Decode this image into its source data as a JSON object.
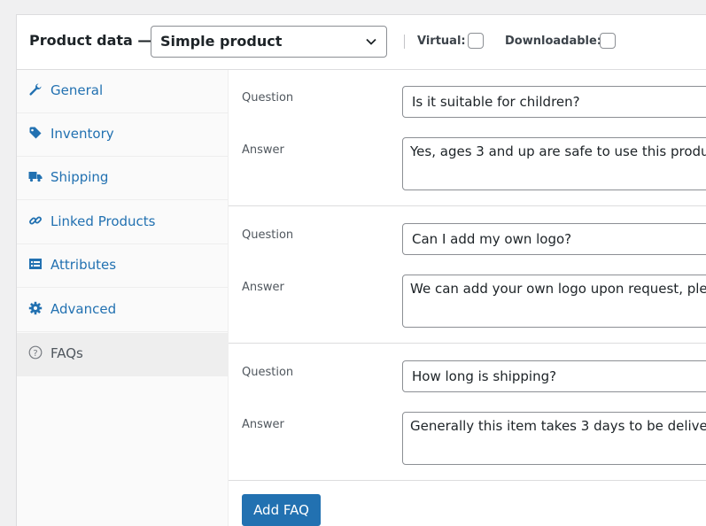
{
  "header": {
    "title": "Product data —",
    "product_type": "Simple product",
    "virtual_label": "Virtual:",
    "downloadable_label": "Downloadable:"
  },
  "sidebar": {
    "items": [
      {
        "label": "General",
        "icon": "wrench-icon"
      },
      {
        "label": "Inventory",
        "icon": "tag-icon"
      },
      {
        "label": "Shipping",
        "icon": "truck-icon"
      },
      {
        "label": "Linked Products",
        "icon": "link-icon"
      },
      {
        "label": "Attributes",
        "icon": "list-icon"
      },
      {
        "label": "Advanced",
        "icon": "gear-icon"
      },
      {
        "label": "FAQs",
        "icon": "help-icon"
      }
    ]
  },
  "faqs": [
    {
      "question_label": "Question",
      "question": "Is it suitable for children?",
      "answer_label": "Answer",
      "answer": "Yes, ages 3 and up are safe to use this produ"
    },
    {
      "question_label": "Question",
      "question": "Can I add my own logo?",
      "answer_label": "Answer",
      "answer": "We can add your own logo upon request, ple"
    },
    {
      "question_label": "Question",
      "question": "How long is shipping?",
      "answer_label": "Answer",
      "answer": "Generally this item takes 3 days to be delive"
    }
  ],
  "add_button": "Add FAQ",
  "colors": {
    "accent": "#2271b1",
    "active_tab_bg": "#eeeeee"
  }
}
